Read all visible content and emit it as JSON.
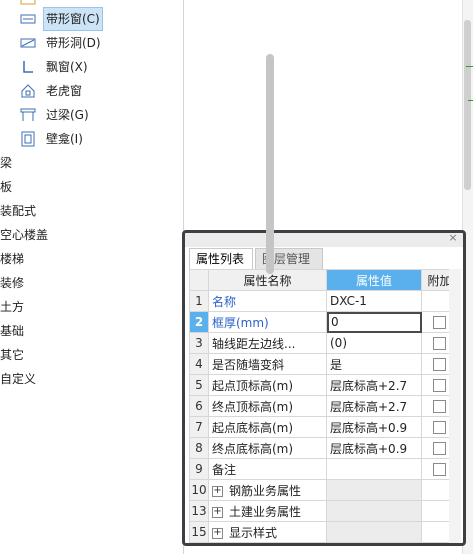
{
  "tree": {
    "children": [
      {
        "label": "带形窗(C)",
        "icon": "ribbon-window-icon",
        "selected": true
      },
      {
        "label": "带形洞(D)",
        "icon": "ribbon-opening-icon"
      },
      {
        "label": "飘窗(X)",
        "icon": "bay-window-icon"
      },
      {
        "label": "老虎窗",
        "icon": "dormer-window-icon"
      },
      {
        "label": "过梁(G)",
        "icon": "lintel-icon"
      },
      {
        "label": "壁龛(I)",
        "icon": "niche-icon"
      }
    ],
    "categories": [
      "梁",
      "板",
      "装配式",
      "空心楼盖",
      "楼梯",
      "装修",
      "土方",
      "基础",
      "其它",
      "自定义"
    ]
  },
  "panel": {
    "tabs": [
      "属性列表",
      "图层管理"
    ],
    "close_glyph": "×",
    "columns": {
      "name": "属性名称",
      "value": "属性值",
      "add": "附加"
    },
    "rows": [
      {
        "num": "1",
        "name": "名称",
        "value": "DXC-1",
        "checkbox": false
      },
      {
        "num": "2",
        "name": "框厚(mm)",
        "value": "0",
        "checkbox": true
      },
      {
        "num": "3",
        "name": "轴线距左边线...",
        "value": "(0)",
        "checkbox": true
      },
      {
        "num": "4",
        "name": "是否随墙变斜",
        "value": "是",
        "checkbox": true
      },
      {
        "num": "5",
        "name": "起点顶标高(m)",
        "value": "层底标高+2.7",
        "checkbox": true
      },
      {
        "num": "6",
        "name": "终点顶标高(m)",
        "value": "层底标高+2.7",
        "checkbox": true
      },
      {
        "num": "7",
        "name": "起点底标高(m)",
        "value": "层底标高+0.9",
        "checkbox": true
      },
      {
        "num": "8",
        "name": "终点底标高(m)",
        "value": "层底标高+0.9",
        "checkbox": true
      },
      {
        "num": "9",
        "name": "备注",
        "value": "",
        "checkbox": true
      },
      {
        "num": "10",
        "name": "钢筋业务属性",
        "value": "",
        "group": true
      },
      {
        "num": "13",
        "name": "土建业务属性",
        "value": "",
        "group": true
      },
      {
        "num": "15",
        "name": "显示样式",
        "value": "",
        "group": true
      }
    ],
    "expand_glyph": "+"
  },
  "colors": {
    "accent": "#5ab0ec",
    "link_text": "#2a62c9",
    "panel_border": "#3c3f44"
  }
}
